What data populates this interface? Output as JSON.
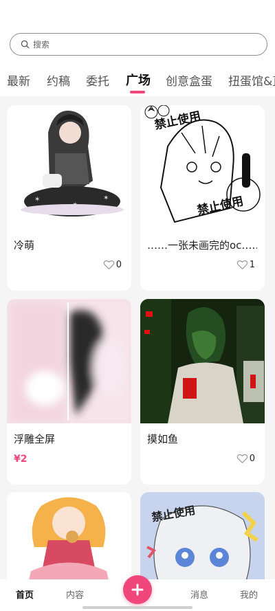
{
  "search": {
    "placeholder": "搜索"
  },
  "tabs": [
    {
      "label": "最新"
    },
    {
      "label": "约稿"
    },
    {
      "label": "委托"
    },
    {
      "label": "广场"
    },
    {
      "label": "创意盒蛋"
    },
    {
      "label": "扭蛋馆&直"
    }
  ],
  "active_tab": "广场",
  "cards": [
    {
      "title": "冷萌",
      "likes": "0"
    },
    {
      "title": "……一张未画完的oc……",
      "likes": "1",
      "watermark": "禁止使用"
    },
    {
      "title": "浮雕全屏",
      "price": "¥2"
    },
    {
      "title": "摸如鱼",
      "likes": "0"
    },
    {
      "title": ""
    },
    {
      "title": "",
      "watermark": "禁止使用"
    }
  ],
  "bottom_nav": [
    {
      "label": "首页"
    },
    {
      "label": "内容"
    },
    {
      "label": "消息"
    },
    {
      "label": "我的"
    }
  ],
  "colors": {
    "accent": "#f0467c",
    "background": "#f5f5f5"
  },
  "icons": {
    "search": "search-icon",
    "like": "heart-icon",
    "create": "plus-icon"
  }
}
